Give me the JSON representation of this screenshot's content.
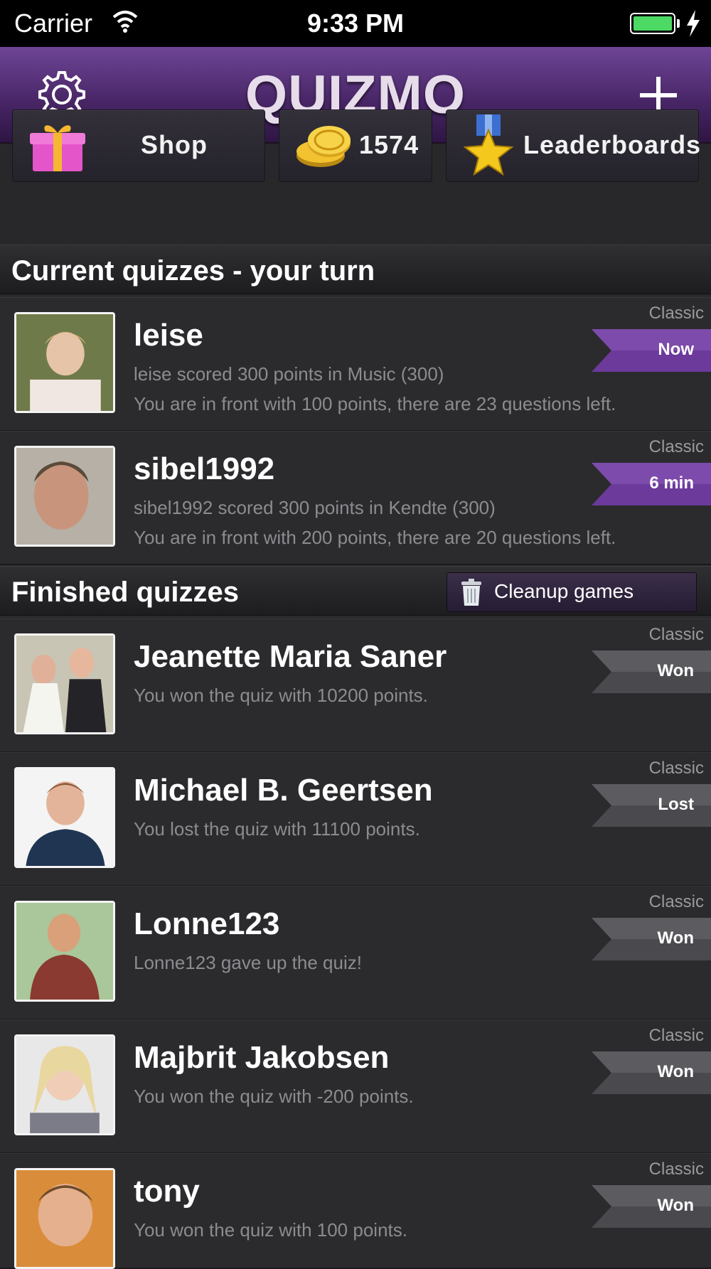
{
  "status": {
    "carrier": "Carrier",
    "time": "9:33 PM"
  },
  "app": {
    "logo": "QUIZMO"
  },
  "toolbar": {
    "shop": "Shop",
    "coins": "1574",
    "leaderboards": "Leaderboards"
  },
  "sections": {
    "current": "Current quizzes - your turn",
    "finished": "Finished quizzes",
    "cleanup": "Cleanup games"
  },
  "current": [
    {
      "name": "leise",
      "line1": "leise scored 300 points in Music (300)",
      "line2": "You are in front with 100 points, there are 23 questions left.",
      "mode": "Classic",
      "status": "Now"
    },
    {
      "name": "sibel1992",
      "line1": "sibel1992 scored 300 points in Kendte (300)",
      "line2": "You are in front with 200 points, there are 20 questions left.",
      "mode": "Classic",
      "status": "6 min"
    }
  ],
  "finished": [
    {
      "name": "Jeanette Maria Saner",
      "line1": "You won the quiz with 10200 points.",
      "mode": "Classic",
      "status": "Won"
    },
    {
      "name": "Michael B. Geertsen",
      "line1": "You lost the quiz with 11100 points.",
      "mode": "Classic",
      "status": "Lost"
    },
    {
      "name": "Lonne123",
      "line1": "Lonne123 gave up the quiz!",
      "mode": "Classic",
      "status": "Won"
    },
    {
      "name": "Majbrit Jakobsen",
      "line1": "You won the quiz with -200 points.",
      "mode": "Classic",
      "status": "Won"
    },
    {
      "name": "tony",
      "line1": "You won the quiz with 100 points.",
      "mode": "Classic",
      "status": "Won"
    }
  ],
  "colors": {
    "accent_purple": "#5a2f82",
    "ribbon_purple": "#6b3a9a",
    "ribbon_gray": "#4a4a4e",
    "battery_green": "#4cd964"
  }
}
